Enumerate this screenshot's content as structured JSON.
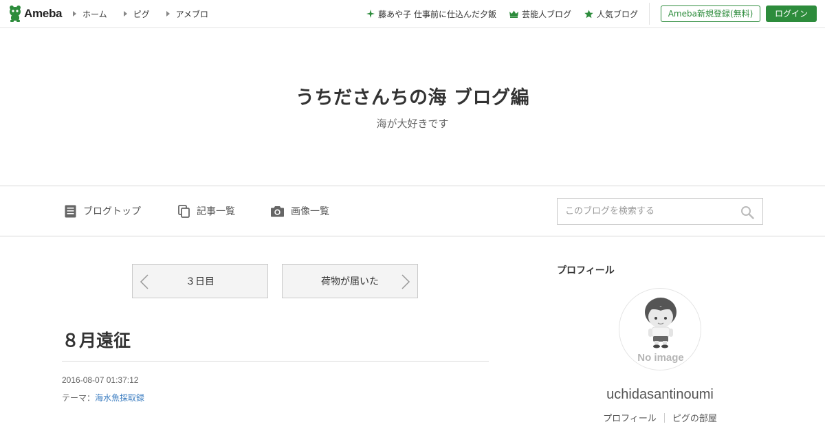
{
  "header": {
    "logo_text": "Ameba",
    "nav": [
      {
        "label": "ホーム"
      },
      {
        "label": "ピグ"
      },
      {
        "label": "アメブロ"
      }
    ],
    "links": [
      {
        "label": "藤あや子 仕事前に仕込んだ夕飯",
        "icon": "sparkle-icon"
      },
      {
        "label": "芸能人ブログ",
        "icon": "crown-icon"
      },
      {
        "label": "人気ブログ",
        "icon": "star-icon"
      }
    ],
    "register_label": "Ameba新規登録(無料)",
    "login_label": "ログイン"
  },
  "blog": {
    "title": "うちださんちの海 ブログ編",
    "description": "海が大好きです"
  },
  "blog_nav": {
    "items": [
      {
        "label": "ブログトップ",
        "icon": "document-icon"
      },
      {
        "label": "記事一覧",
        "icon": "copy-icon"
      },
      {
        "label": "画像一覧",
        "icon": "camera-icon"
      }
    ],
    "search_placeholder": "このブログを検索する"
  },
  "article": {
    "prev_label": "３日目",
    "next_label": "荷物が届いた",
    "title": "８月遠征",
    "date": "2016-08-07 01:37:12",
    "theme_prefix": "テーマ：",
    "theme_link": "海水魚採取録"
  },
  "sidebar": {
    "profile_heading": "プロフィール",
    "avatar_text": "No image",
    "username": "uchidasantinoumi",
    "links": [
      {
        "label": "プロフィール"
      },
      {
        "label": "ピグの部屋"
      }
    ]
  },
  "colors": {
    "brand_green": "#2d8c3c",
    "link_blue": "#3d7ec1"
  }
}
